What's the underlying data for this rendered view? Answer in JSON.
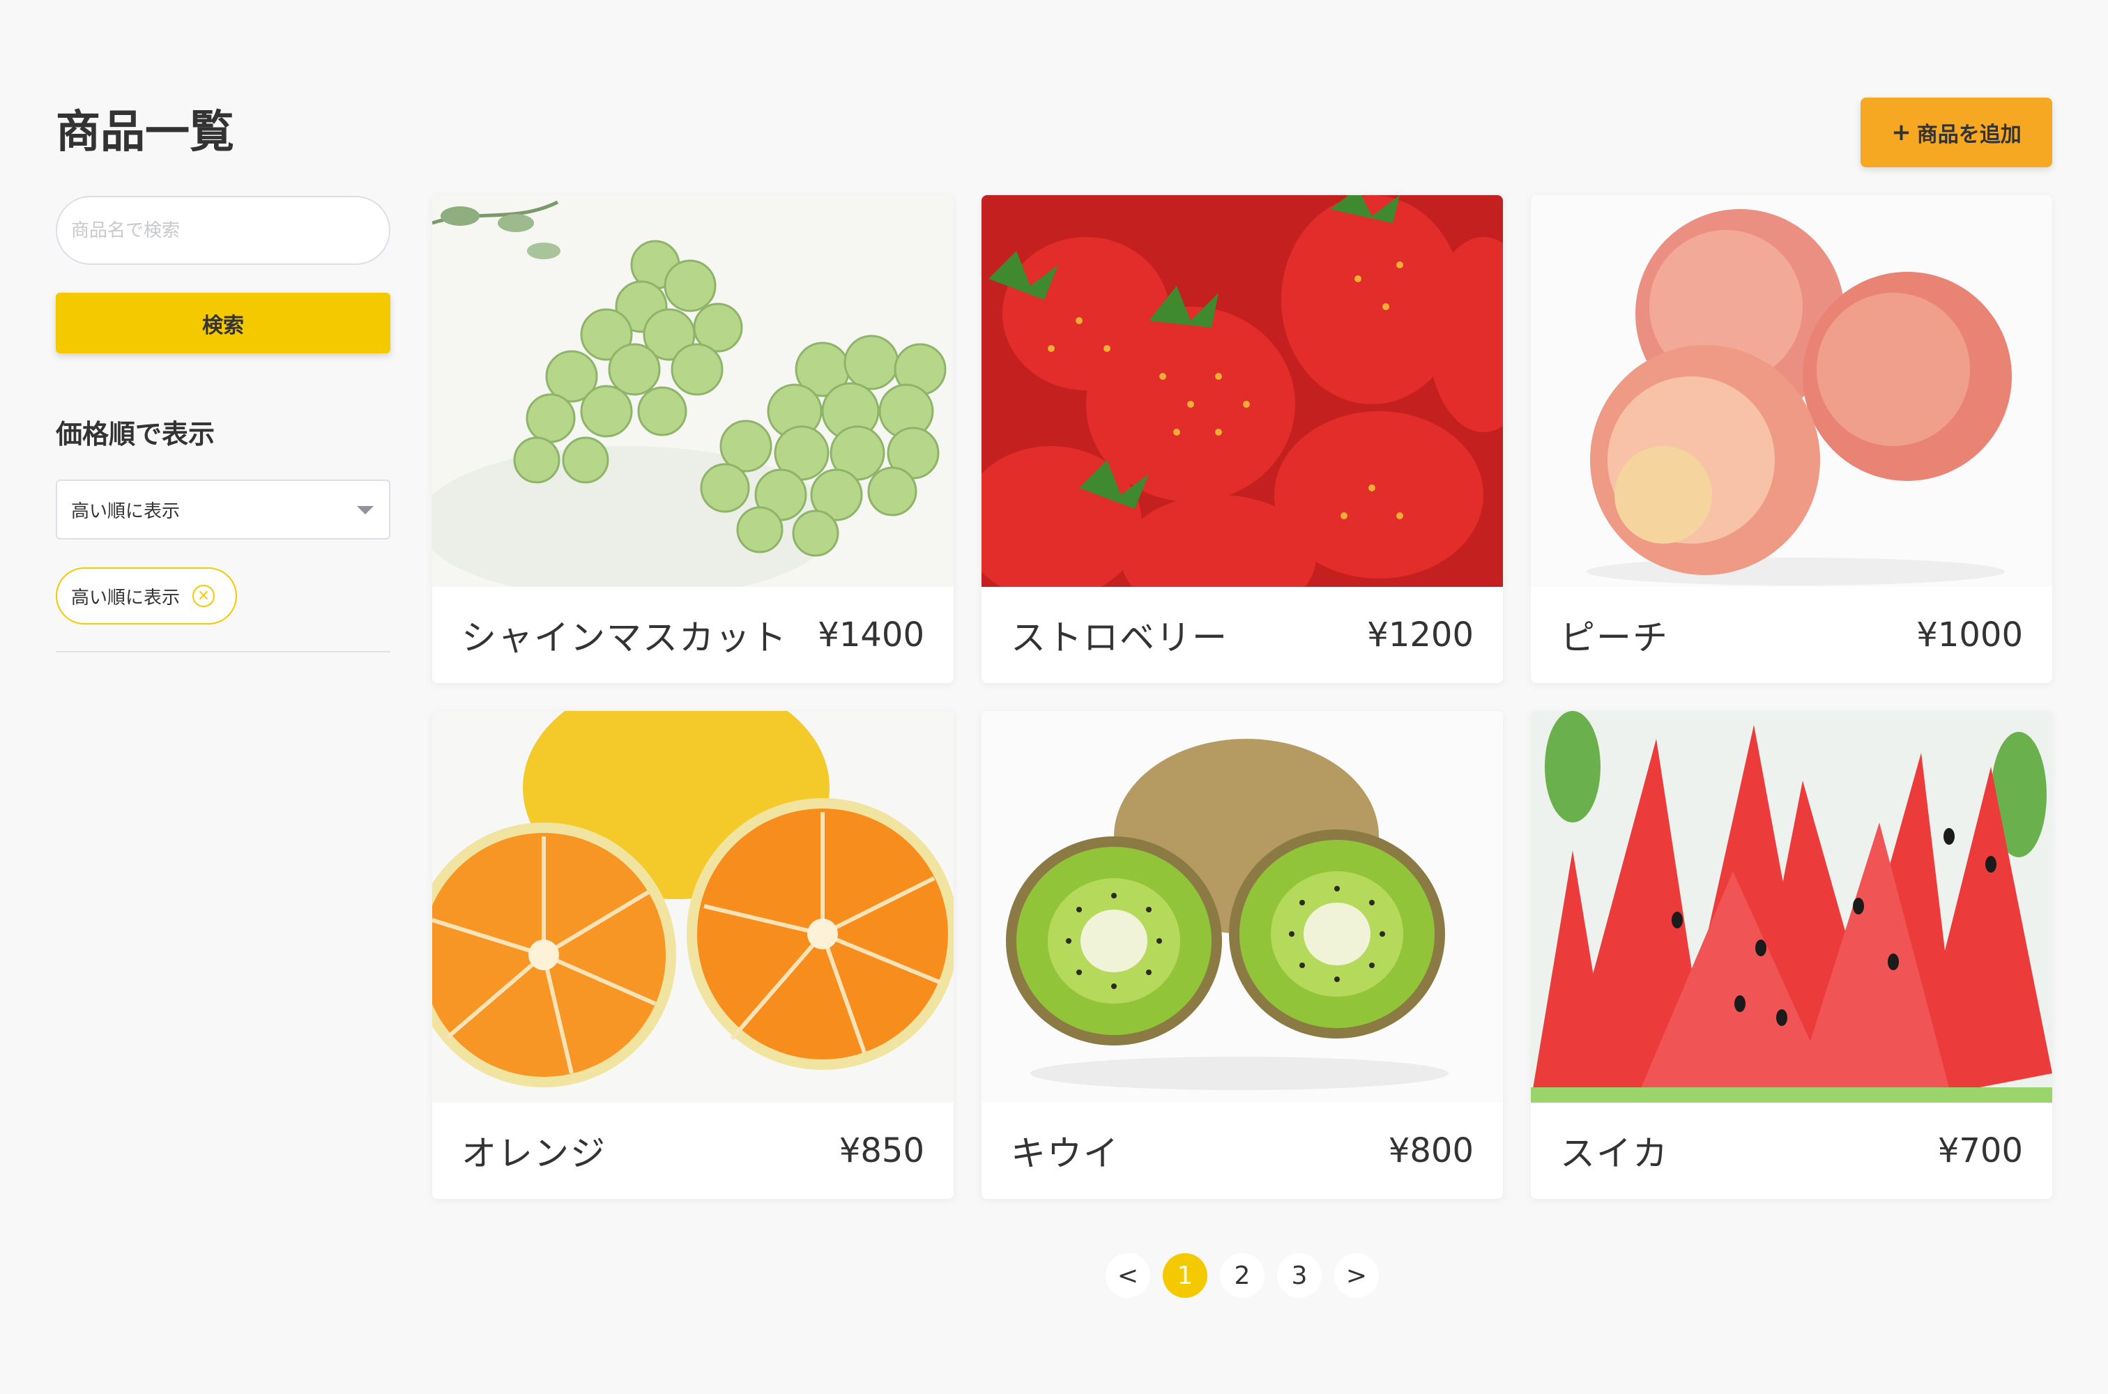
{
  "page": {
    "title": "商品一覧"
  },
  "header": {
    "add_button_label": "商品を追加",
    "add_icon": "plus-icon"
  },
  "sidebar": {
    "search_placeholder": "商品名で検索",
    "search_value": "",
    "search_button_label": "検索",
    "sort_heading": "価格順で表示",
    "sort_selected": "高い順に表示",
    "sort_tag_label": "高い順に表示"
  },
  "products": [
    {
      "name": "シャインマスカット",
      "price": "¥1400",
      "image": "grapes"
    },
    {
      "name": "ストロベリー",
      "price": "¥1200",
      "image": "strawberries"
    },
    {
      "name": "ピーチ",
      "price": "¥1000",
      "image": "peaches"
    },
    {
      "name": "オレンジ",
      "price": "¥850",
      "image": "oranges"
    },
    {
      "name": "キウイ",
      "price": "¥800",
      "image": "kiwis"
    },
    {
      "name": "スイカ",
      "price": "¥700",
      "image": "watermelon"
    }
  ],
  "pagination": {
    "prev": "<",
    "pages": [
      "1",
      "2",
      "3"
    ],
    "current": "1",
    "next": ">"
  }
}
